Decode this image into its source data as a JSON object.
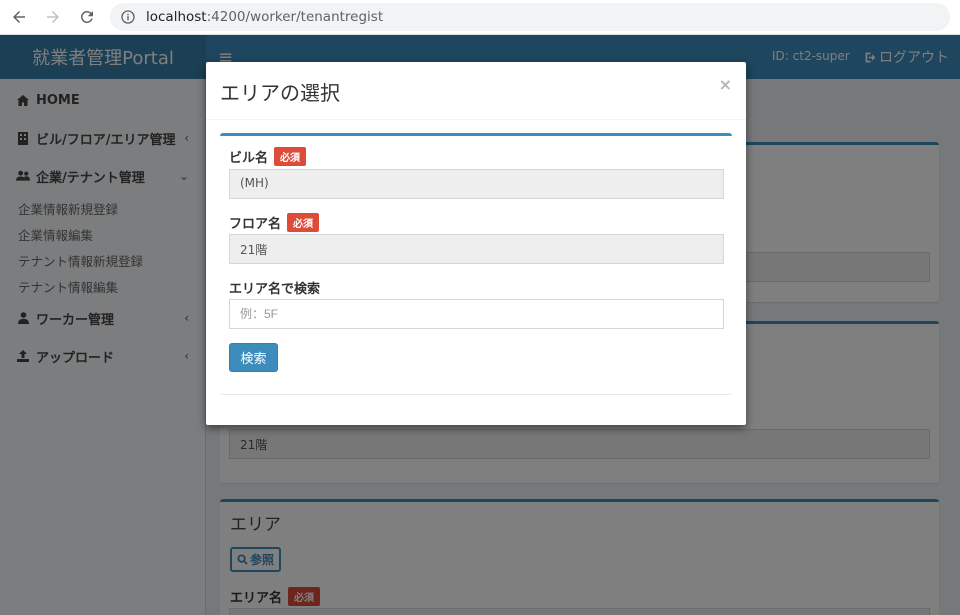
{
  "browser": {
    "url_host": "localhost",
    "url_rest": ":4200/worker/tenantregist"
  },
  "header": {
    "logo": "就業者管理Portal",
    "hamburger": "≡",
    "user_id": "ID: ct2-super",
    "logout": "ログアウト"
  },
  "sidebar": {
    "home": "HOME",
    "building": "ビル/フロア/エリア管理",
    "company": "企業/テナント管理",
    "sub_items": [
      "企業情報新規登録",
      "企業情報編集",
      "テナント情報新規登録",
      "テナント情報編集"
    ],
    "worker": "ワーカー管理",
    "upload": "アップロード"
  },
  "background": {
    "floor_value": "21階",
    "area_title": "エリア",
    "ref_button": "参照",
    "area_label": "エリア名",
    "required": "必須"
  },
  "modal": {
    "title": "エリアの選択",
    "close": "×",
    "building_label": "ビル名",
    "building_value": "(MH)",
    "floor_label": "フロア名",
    "floor_value": "21階",
    "search_label": "エリア名で検索",
    "search_placeholder": "例：5F",
    "required": "必須",
    "search_button": "検索"
  }
}
